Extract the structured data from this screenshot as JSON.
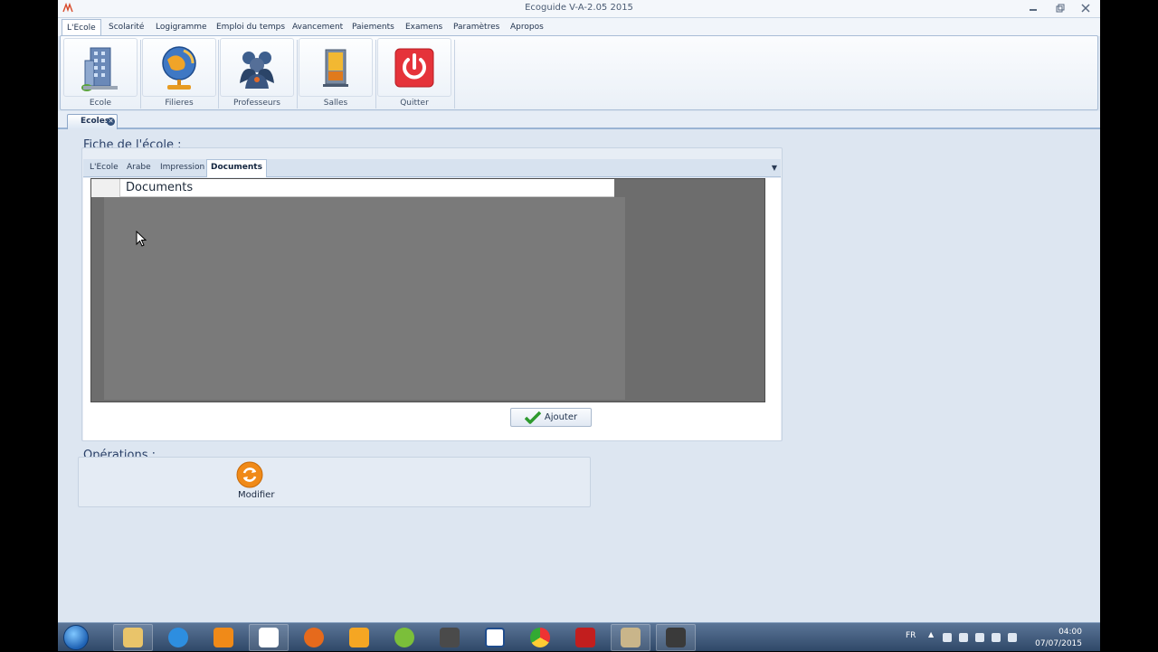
{
  "window": {
    "title": "Ecoguide V-A-2.05 2015"
  },
  "menu": {
    "tabs": [
      {
        "label": "L'Ecole"
      },
      {
        "label": "Scolarité"
      },
      {
        "label": "Logigramme"
      },
      {
        "label": "Emploi du temps"
      },
      {
        "label": "Avancement"
      },
      {
        "label": "Paiements"
      },
      {
        "label": "Examens"
      },
      {
        "label": "Paramètres"
      },
      {
        "label": "Apropos"
      }
    ],
    "active": "L'Ecole"
  },
  "ribbon": {
    "buttons": [
      {
        "label": "Ecole",
        "icon": "building-icon"
      },
      {
        "label": "Filieres",
        "icon": "globe-icon"
      },
      {
        "label": "Professeurs",
        "icon": "people-icon"
      },
      {
        "label": "Salles",
        "icon": "door-icon"
      },
      {
        "label": "Quitter",
        "icon": "power-icon"
      }
    ]
  },
  "doc_tab": {
    "label": "Ecoles"
  },
  "fiche": {
    "title": "Fiche de l'école :",
    "tabs": [
      {
        "label": "L'Ecole"
      },
      {
        "label": "Arabe"
      },
      {
        "label": "Impression"
      },
      {
        "label": "Documents"
      }
    ],
    "active_tab": "Documents",
    "grid": {
      "column": "Documents"
    },
    "add_button": "Ajouter"
  },
  "operations": {
    "title": "Opérations :",
    "modify_label": "Modifier"
  },
  "taskbar": {
    "lang": "FR",
    "time": "04:00",
    "date": "07/07/2015"
  },
  "colors": {
    "accent": "#2a4068",
    "quit_red": "#e5333a",
    "ok_green": "#2e9a2e",
    "modify_orange": "#f08a18"
  }
}
